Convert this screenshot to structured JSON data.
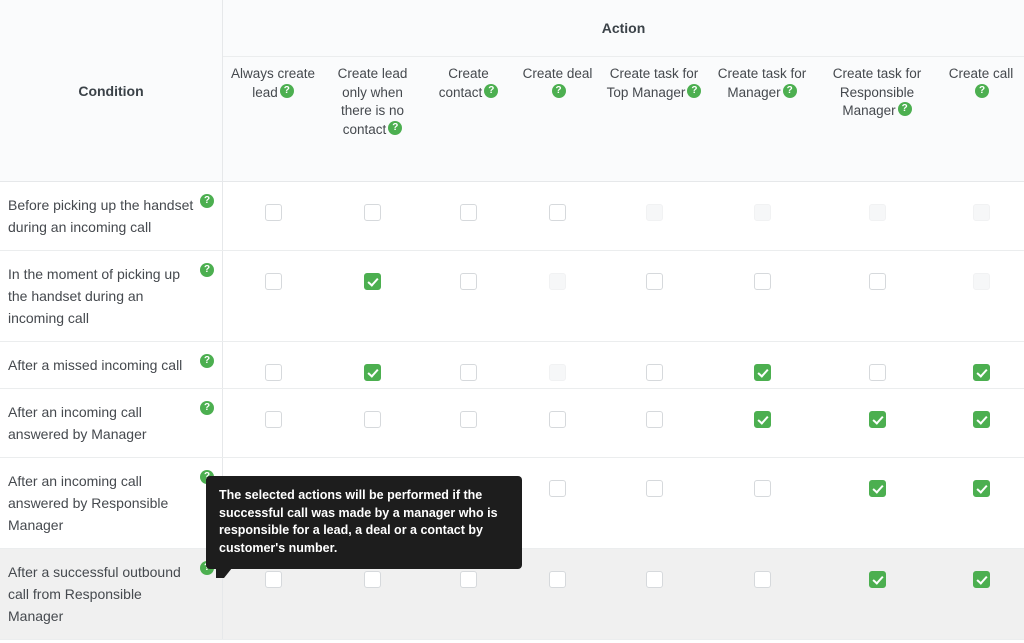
{
  "header": {
    "condition_label": "Condition",
    "action_label": "Action",
    "help_icon": "help-circle-icon",
    "columns": [
      {
        "label": "Always create lead",
        "help": "help-circle-icon"
      },
      {
        "label": "Create lead only when there is no contact",
        "help": "help-circle-icon"
      },
      {
        "label": "Create contact",
        "help": "help-circle-icon"
      },
      {
        "label": "Create deal",
        "help": "help-circle-icon"
      },
      {
        "label": "Create task for Top Manager",
        "help": "help-circle-icon"
      },
      {
        "label": "Create task for Manager",
        "help": "help-circle-icon"
      },
      {
        "label": "Create task for Responsible Manager",
        "help": "help-circle-icon"
      },
      {
        "label": "Create call",
        "help": "help-circle-icon"
      }
    ]
  },
  "rows": [
    {
      "condition": "Before picking up the handset during an incoming call",
      "help": "help-circle-icon",
      "hovered": false,
      "cells": [
        {
          "checked": false,
          "disabled": false
        },
        {
          "checked": false,
          "disabled": false
        },
        {
          "checked": false,
          "disabled": false
        },
        {
          "checked": false,
          "disabled": false
        },
        {
          "checked": false,
          "disabled": true
        },
        {
          "checked": false,
          "disabled": true
        },
        {
          "checked": false,
          "disabled": true
        },
        {
          "checked": false,
          "disabled": true
        }
      ]
    },
    {
      "condition": "In the moment of picking up the handset during an incoming call",
      "help": "help-circle-icon",
      "hovered": false,
      "cells": [
        {
          "checked": false,
          "disabled": false
        },
        {
          "checked": true,
          "disabled": false
        },
        {
          "checked": false,
          "disabled": false
        },
        {
          "checked": false,
          "disabled": true
        },
        {
          "checked": false,
          "disabled": false
        },
        {
          "checked": false,
          "disabled": false
        },
        {
          "checked": false,
          "disabled": false
        },
        {
          "checked": false,
          "disabled": true
        }
      ]
    },
    {
      "condition": "After a missed incoming call",
      "help": "help-circle-icon",
      "hovered": false,
      "cells": [
        {
          "checked": false,
          "disabled": false
        },
        {
          "checked": true,
          "disabled": false
        },
        {
          "checked": false,
          "disabled": false
        },
        {
          "checked": false,
          "disabled": true
        },
        {
          "checked": false,
          "disabled": false
        },
        {
          "checked": true,
          "disabled": false
        },
        {
          "checked": false,
          "disabled": false
        },
        {
          "checked": true,
          "disabled": false
        }
      ]
    },
    {
      "condition": "After an incoming call answered by Manager",
      "help": "help-circle-icon",
      "hovered": false,
      "cells": [
        {
          "checked": false,
          "disabled": false
        },
        {
          "checked": false,
          "disabled": false
        },
        {
          "checked": false,
          "disabled": false
        },
        {
          "checked": false,
          "disabled": false
        },
        {
          "checked": false,
          "disabled": false
        },
        {
          "checked": true,
          "disabled": false
        },
        {
          "checked": true,
          "disabled": false
        },
        {
          "checked": true,
          "disabled": false
        }
      ]
    },
    {
      "condition": "After an incoming call answered by Responsible Manager",
      "help": "help-circle-icon",
      "hovered": false,
      "cells": [
        {
          "checked": false,
          "disabled": false
        },
        {
          "checked": false,
          "disabled": false
        },
        {
          "checked": false,
          "disabled": false
        },
        {
          "checked": false,
          "disabled": false
        },
        {
          "checked": false,
          "disabled": false
        },
        {
          "checked": false,
          "disabled": false
        },
        {
          "checked": true,
          "disabled": false
        },
        {
          "checked": true,
          "disabled": false
        }
      ]
    },
    {
      "condition": "After a successful outbound call from Responsible Manager",
      "help": "help-circle-icon",
      "hovered": true,
      "cells": [
        {
          "checked": false,
          "disabled": false
        },
        {
          "checked": false,
          "disabled": false
        },
        {
          "checked": false,
          "disabled": false
        },
        {
          "checked": false,
          "disabled": false
        },
        {
          "checked": false,
          "disabled": false
        },
        {
          "checked": false,
          "disabled": false
        },
        {
          "checked": true,
          "disabled": false
        },
        {
          "checked": true,
          "disabled": false
        }
      ]
    }
  ],
  "tooltip": {
    "text": "The selected actions will be performed if the successful call was made by a manager who is responsible for a lead, a deal or a contact by customer's number."
  },
  "colors": {
    "accent_green": "#4caf50",
    "tooltip_bg": "#1d1d1d",
    "header_bg": "#fafbfc",
    "row_hover_bg": "#f0f0f0",
    "border": "#e6e8ea"
  }
}
